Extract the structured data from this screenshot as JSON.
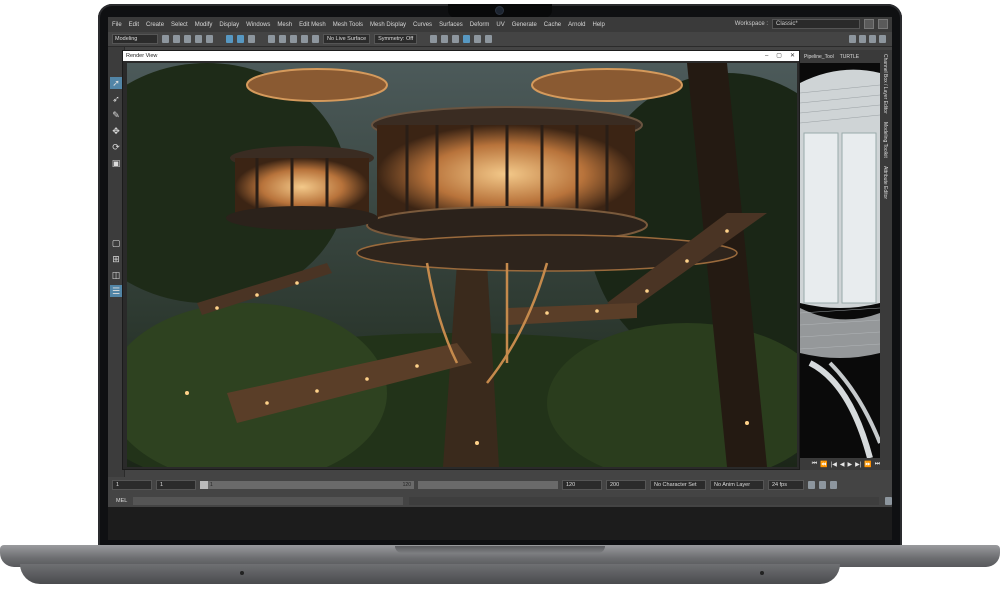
{
  "menubar": {
    "items": [
      "File",
      "Edit",
      "Create",
      "Select",
      "Modify",
      "Display",
      "Windows",
      "Mesh",
      "Edit Mesh",
      "Mesh Tools",
      "Mesh Display",
      "Curves",
      "Surfaces",
      "Deform",
      "UV",
      "Generate",
      "Cache",
      "Arnold",
      "Help"
    ],
    "workspace_label": "Workspace :",
    "workspace_value": "Classic*"
  },
  "shelf": {
    "mode": "Modeling",
    "live_surface": "No Live Surface",
    "symmetry": "Symmetry: Off"
  },
  "render_window": {
    "title": "Render View",
    "controls": [
      "–",
      "▢",
      "✕"
    ]
  },
  "right_panel": {
    "tabs": [
      "Pipeline_Tool",
      "TURTLE"
    ],
    "side_tabs": [
      "Channel Box / Layer Editor",
      "Modeling Toolkit",
      "Attribute Editor"
    ]
  },
  "playback": {
    "buttons": [
      "⏮",
      "⏪",
      "|◀",
      "◀",
      "▶",
      "▶|",
      "⏩",
      "⏭"
    ]
  },
  "timebar": {
    "start_frame": "1",
    "current_frame": "1",
    "range_start": "1",
    "range_end": "120",
    "end_frame": "120",
    "max_frame": "200",
    "character_set": "No Character Set",
    "anim_layer": "No Anim Layer",
    "fps": "24 fps"
  },
  "command_line": {
    "label": "MEL"
  }
}
